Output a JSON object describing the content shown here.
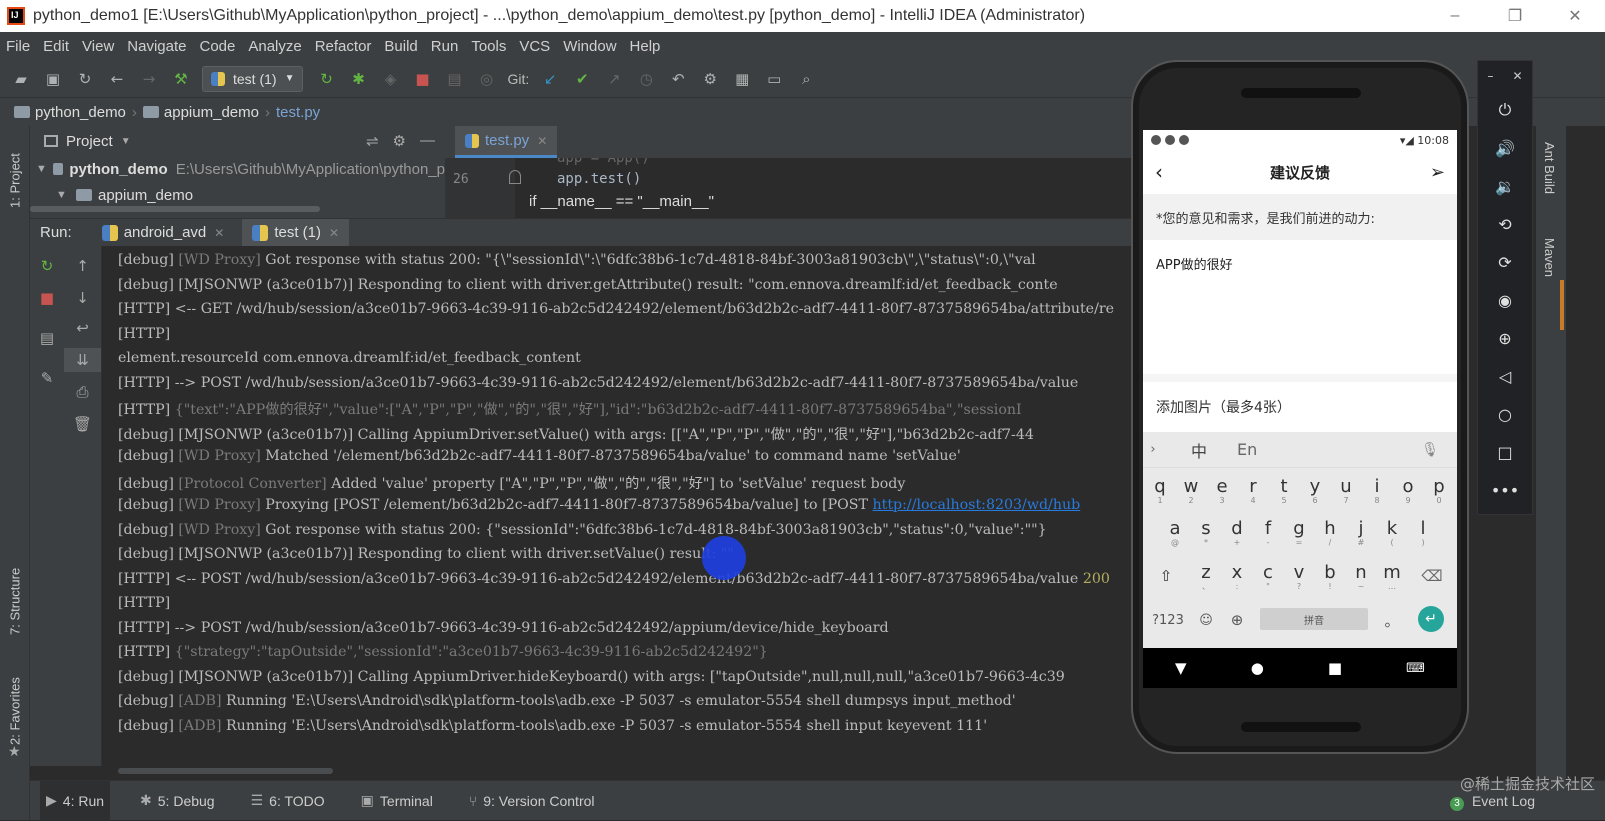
{
  "window": {
    "title": "python_demo1 [E:\\Users\\Github\\MyApplication\\python_project] - ...\\python_demo\\appium_demo\\test.py [python_demo] - IntelliJ IDEA (Administrator)",
    "minimize": "–",
    "restore": "❐",
    "close": "✕"
  },
  "menu": [
    "File",
    "Edit",
    "View",
    "Navigate",
    "Code",
    "Analyze",
    "Refactor",
    "Build",
    "Run",
    "Tools",
    "VCS",
    "Window",
    "Help"
  ],
  "toolbar": {
    "run_config": "test (1)",
    "git_label": "Git:"
  },
  "breadcrumb": {
    "project": "python_demo",
    "folder": "appium_demo",
    "file": "test.py"
  },
  "left_tabs": {
    "project": "1: Project",
    "structure": "7: Structure",
    "favorites": "2: Favorites"
  },
  "project_panel": {
    "title": "Project",
    "root_name": "python_demo",
    "root_path": "E:\\Users\\Github\\MyApplication\\python_p",
    "child": "appium_demo"
  },
  "editor": {
    "tab": "test.py",
    "line_number": "26",
    "code_line_prev": "app = App()",
    "code_line": "app.test()",
    "code_line_next": "if __name__ == \"__main__\""
  },
  "run_panel": {
    "label": "Run:",
    "tabs": [
      "android_avd",
      "test (1)"
    ]
  },
  "console": [
    {
      "pre": "[debug] ",
      "tag": "[WD Proxy]",
      "text": " Got response with status 200: \"{\\\"sessionId\\\":\\\"6dfc38b6-1c7d-4818-84bf-3003a81903cb\\\",\\\"status\\\":0,\\\"val"
    },
    {
      "pre": "[debug] ",
      "tag": "",
      "text": "[MJSONWP (a3ce01b7)] Responding to client with driver.getAttribute() result: \"com.ennova.dreamlf:id/et_feedback_conte"
    },
    {
      "pre": "[HTTP] ",
      "tag": "",
      "text": "<-- GET /wd/hub/session/a3ce01b7-9663-4c39-9116-ab2c5d242492/element/b63d2b2c-adf7-4411-80f7-8737589654ba/attribute/re"
    },
    {
      "pre": "[HTTP]",
      "tag": "",
      "text": ""
    },
    {
      "pre": "",
      "tag": "",
      "text": "element.resourceId com.ennova.dreamlf:id/et_feedback_content"
    },
    {
      "pre": "[HTTP] ",
      "tag": "",
      "text": "--> POST /wd/hub/session/a3ce01b7-9663-4c39-9116-ab2c5d242492/element/b63d2b2c-adf7-4411-80f7-8737589654ba/value"
    },
    {
      "pre": "[HTTP] ",
      "tag": "{\"text\":\"APP做的很好\",\"value\":[\"A\",\"P\",\"P\",\"做\",\"的\",\"很\",\"好\"],\"id\":\"b63d2b2c-adf7-4411-80f7-8737589654ba\",\"sessionI",
      "text": ""
    },
    {
      "pre": "[debug] ",
      "tag": "",
      "text": "[MJSONWP (a3ce01b7)] Calling AppiumDriver.setValue() with args: [[\"A\",\"P\",\"P\",\"做\",\"的\",\"很\",\"好\"],\"b63d2b2c-adf7-44"
    },
    {
      "pre": "[debug] ",
      "tag": "[WD Proxy]",
      "text": " Matched '/element/b63d2b2c-adf7-4411-80f7-8737589654ba/value' to command name 'setValue'"
    },
    {
      "pre": "[debug] ",
      "tag": "[Protocol Converter]",
      "text": " Added 'value' property [\"A\",\"P\",\"P\",\"做\",\"的\",\"很\",\"好\"] to 'setValue' request body"
    },
    {
      "pre": "[debug] ",
      "tag": "[WD Proxy]",
      "text": " Proxying [POST /element/b63d2b2c-adf7-4411-80f7-8737589654ba/value] to [POST ",
      "link": "http://localhost:8203/wd/hub"
    },
    {
      "pre": "[debug] ",
      "tag": "[WD Proxy]",
      "text": " Got response with status 200: {\"sessionId\":\"6dfc38b6-1c7d-4818-84bf-3003a81903cb\",\"status\":0,\"value\":\"\"}"
    },
    {
      "pre": "[debug] ",
      "tag": "",
      "text": "[MJSONWP (a3ce01b7)] Responding to client with driver.setValue() result: \"\""
    },
    {
      "pre": "[HTTP] ",
      "tag": "",
      "text": "<-- POST /wd/hub/session/a3ce01b7-9663-4c39-9116-ab2c5d242492/element/b63d2b2c-adf7-4411-80f7-8737589654ba/value ",
      "num": "200"
    },
    {
      "pre": "[HTTP]",
      "tag": "",
      "text": ""
    },
    {
      "pre": "[HTTP] ",
      "tag": "",
      "text": "--> POST /wd/hub/session/a3ce01b7-9663-4c39-9116-ab2c5d242492/appium/device/hide_keyboard"
    },
    {
      "pre": "[HTTP] ",
      "tag": "{\"strategy\":\"tapOutside\",\"sessionId\":\"a3ce01b7-9663-4c39-9116-ab2c5d242492\"}",
      "text": ""
    },
    {
      "pre": "[debug] ",
      "tag": "",
      "text": "[MJSONWP (a3ce01b7)] Calling AppiumDriver.hideKeyboard() with args: [\"tapOutside\",null,null,null,\"a3ce01b7-9663-4c39"
    },
    {
      "pre": "[debug] ",
      "tag": "[ADB]",
      "text": " Running 'E:\\Users\\Android\\sdk\\platform-tools\\adb.exe -P 5037 -s emulator-5554 shell dumpsys input_method'"
    },
    {
      "pre": "[debug] ",
      "tag": "[ADB]",
      "text": " Running 'E:\\Users\\Android\\sdk\\platform-tools\\adb.exe -P 5037 -s emulator-5554 shell input keyevent 111'"
    }
  ],
  "status_bar": {
    "tabs": [
      {
        "icon": "▶",
        "label": "4: Run"
      },
      {
        "icon": "✱",
        "label": "5: Debug"
      },
      {
        "icon": "☰",
        "label": "6: TODO"
      },
      {
        "icon": "▣",
        "label": "Terminal"
      },
      {
        "icon": "⑂",
        "label": "9: Version Control"
      }
    ],
    "event_log": "Event Log",
    "event_count": "3"
  },
  "right_tabs": {
    "ant": "Ant Build",
    "maven": "Maven"
  },
  "watermark": "@稀土掘金技术社区",
  "phone": {
    "time": "10:08",
    "title": "建议反馈",
    "prompt": "*您的意见和需求，是我们前进的动力:",
    "feedback_text": "APP做的很好",
    "add_images": "添加图片（最多4张）",
    "ime_zh": "中",
    "ime_en": "En",
    "rows": [
      {
        "keys": [
          "q",
          "w",
          "e",
          "r",
          "t",
          "y",
          "u",
          "i",
          "o",
          "p"
        ],
        "subs": [
          "1",
          "2",
          "3",
          "4",
          "5",
          "6",
          "7",
          "8",
          "9",
          "0"
        ]
      },
      {
        "keys": [
          "a",
          "s",
          "d",
          "f",
          "g",
          "h",
          "j",
          "k",
          "l"
        ],
        "subs": [
          "@",
          "*",
          "+",
          "-",
          "=",
          "/",
          "#",
          "(",
          ")"
        ]
      },
      {
        "keys": [
          "z",
          "x",
          "c",
          "v",
          "b",
          "n",
          "m"
        ],
        "subs": [
          "、",
          ":",
          "\"",
          "?",
          "!",
          "~",
          "…"
        ]
      }
    ],
    "sym_key": "?123",
    "space_label": "拼音",
    "period": "。"
  },
  "emulator": {
    "minimize": "–",
    "close": "✕"
  }
}
